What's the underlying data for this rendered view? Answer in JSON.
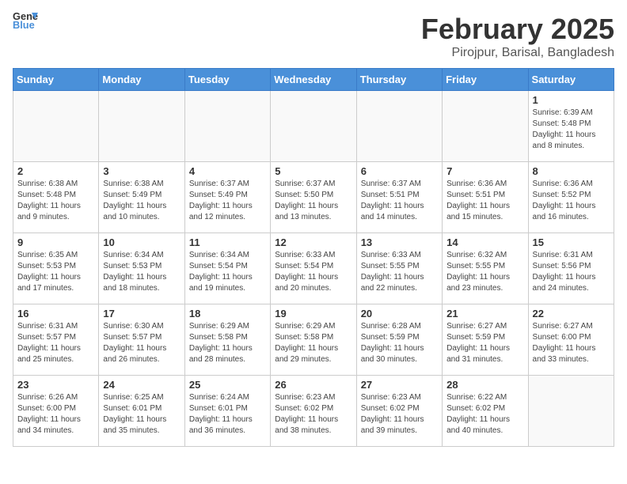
{
  "header": {
    "logo_general": "General",
    "logo_blue": "Blue",
    "title": "February 2025",
    "subtitle": "Pirojpur, Barisal, Bangladesh"
  },
  "weekdays": [
    "Sunday",
    "Monday",
    "Tuesday",
    "Wednesday",
    "Thursday",
    "Friday",
    "Saturday"
  ],
  "weeks": [
    [
      {
        "day": "",
        "info": ""
      },
      {
        "day": "",
        "info": ""
      },
      {
        "day": "",
        "info": ""
      },
      {
        "day": "",
        "info": ""
      },
      {
        "day": "",
        "info": ""
      },
      {
        "day": "",
        "info": ""
      },
      {
        "day": "1",
        "info": "Sunrise: 6:39 AM\nSunset: 5:48 PM\nDaylight: 11 hours and 8 minutes."
      }
    ],
    [
      {
        "day": "2",
        "info": "Sunrise: 6:38 AM\nSunset: 5:48 PM\nDaylight: 11 hours and 9 minutes."
      },
      {
        "day": "3",
        "info": "Sunrise: 6:38 AM\nSunset: 5:49 PM\nDaylight: 11 hours and 10 minutes."
      },
      {
        "day": "4",
        "info": "Sunrise: 6:37 AM\nSunset: 5:49 PM\nDaylight: 11 hours and 12 minutes."
      },
      {
        "day": "5",
        "info": "Sunrise: 6:37 AM\nSunset: 5:50 PM\nDaylight: 11 hours and 13 minutes."
      },
      {
        "day": "6",
        "info": "Sunrise: 6:37 AM\nSunset: 5:51 PM\nDaylight: 11 hours and 14 minutes."
      },
      {
        "day": "7",
        "info": "Sunrise: 6:36 AM\nSunset: 5:51 PM\nDaylight: 11 hours and 15 minutes."
      },
      {
        "day": "8",
        "info": "Sunrise: 6:36 AM\nSunset: 5:52 PM\nDaylight: 11 hours and 16 minutes."
      }
    ],
    [
      {
        "day": "9",
        "info": "Sunrise: 6:35 AM\nSunset: 5:53 PM\nDaylight: 11 hours and 17 minutes."
      },
      {
        "day": "10",
        "info": "Sunrise: 6:34 AM\nSunset: 5:53 PM\nDaylight: 11 hours and 18 minutes."
      },
      {
        "day": "11",
        "info": "Sunrise: 6:34 AM\nSunset: 5:54 PM\nDaylight: 11 hours and 19 minutes."
      },
      {
        "day": "12",
        "info": "Sunrise: 6:33 AM\nSunset: 5:54 PM\nDaylight: 11 hours and 20 minutes."
      },
      {
        "day": "13",
        "info": "Sunrise: 6:33 AM\nSunset: 5:55 PM\nDaylight: 11 hours and 22 minutes."
      },
      {
        "day": "14",
        "info": "Sunrise: 6:32 AM\nSunset: 5:55 PM\nDaylight: 11 hours and 23 minutes."
      },
      {
        "day": "15",
        "info": "Sunrise: 6:31 AM\nSunset: 5:56 PM\nDaylight: 11 hours and 24 minutes."
      }
    ],
    [
      {
        "day": "16",
        "info": "Sunrise: 6:31 AM\nSunset: 5:57 PM\nDaylight: 11 hours and 25 minutes."
      },
      {
        "day": "17",
        "info": "Sunrise: 6:30 AM\nSunset: 5:57 PM\nDaylight: 11 hours and 26 minutes."
      },
      {
        "day": "18",
        "info": "Sunrise: 6:29 AM\nSunset: 5:58 PM\nDaylight: 11 hours and 28 minutes."
      },
      {
        "day": "19",
        "info": "Sunrise: 6:29 AM\nSunset: 5:58 PM\nDaylight: 11 hours and 29 minutes."
      },
      {
        "day": "20",
        "info": "Sunrise: 6:28 AM\nSunset: 5:59 PM\nDaylight: 11 hours and 30 minutes."
      },
      {
        "day": "21",
        "info": "Sunrise: 6:27 AM\nSunset: 5:59 PM\nDaylight: 11 hours and 31 minutes."
      },
      {
        "day": "22",
        "info": "Sunrise: 6:27 AM\nSunset: 6:00 PM\nDaylight: 11 hours and 33 minutes."
      }
    ],
    [
      {
        "day": "23",
        "info": "Sunrise: 6:26 AM\nSunset: 6:00 PM\nDaylight: 11 hours and 34 minutes."
      },
      {
        "day": "24",
        "info": "Sunrise: 6:25 AM\nSunset: 6:01 PM\nDaylight: 11 hours and 35 minutes."
      },
      {
        "day": "25",
        "info": "Sunrise: 6:24 AM\nSunset: 6:01 PM\nDaylight: 11 hours and 36 minutes."
      },
      {
        "day": "26",
        "info": "Sunrise: 6:23 AM\nSunset: 6:02 PM\nDaylight: 11 hours and 38 minutes."
      },
      {
        "day": "27",
        "info": "Sunrise: 6:23 AM\nSunset: 6:02 PM\nDaylight: 11 hours and 39 minutes."
      },
      {
        "day": "28",
        "info": "Sunrise: 6:22 AM\nSunset: 6:02 PM\nDaylight: 11 hours and 40 minutes."
      },
      {
        "day": "",
        "info": ""
      }
    ]
  ]
}
